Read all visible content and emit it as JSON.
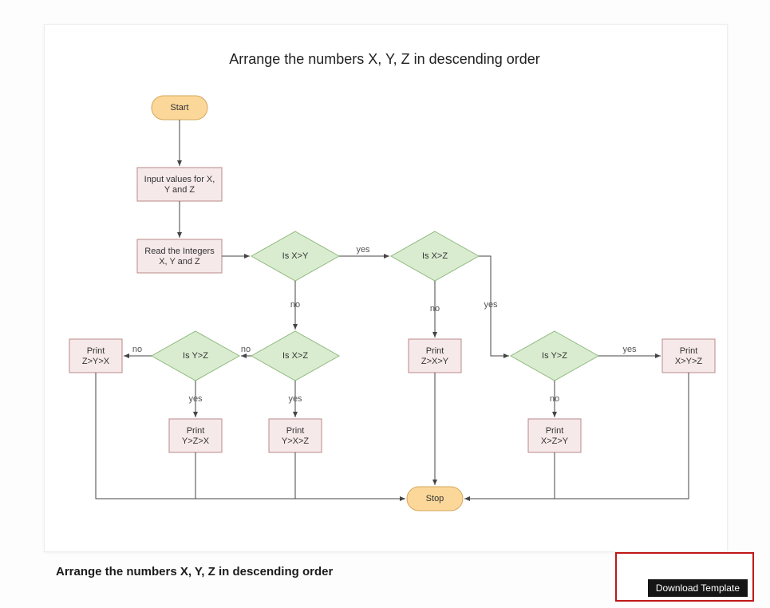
{
  "chart_data": {
    "type": "flowchart",
    "title": "Arrange the numbers X, Y, Z in descending order",
    "nodes": {
      "start": {
        "shape": "terminator",
        "label": "Start"
      },
      "input": {
        "shape": "process",
        "label": "Input values for X, Y and Z"
      },
      "read": {
        "shape": "process",
        "label": "Read the Integers X, Y and Z"
      },
      "dec_xy": {
        "shape": "decision",
        "label": "Is X>Y"
      },
      "dec_xz_top": {
        "shape": "decision",
        "label": "Is X>Z"
      },
      "dec_xz_mid": {
        "shape": "decision",
        "label": "Is X>Z"
      },
      "dec_yz_l": {
        "shape": "decision",
        "label": "Is Y>Z"
      },
      "dec_yz_r": {
        "shape": "decision",
        "label": "Is Y>Z"
      },
      "p_zyx": {
        "shape": "process",
        "label": "Print\nZ>Y>X"
      },
      "p_zxy": {
        "shape": "process",
        "label": "Print\nZ>X>Y"
      },
      "p_yzx": {
        "shape": "process",
        "label": "Print\nY>Z>X"
      },
      "p_yxz": {
        "shape": "process",
        "label": "Print\nY>X>Z"
      },
      "p_xzy": {
        "shape": "process",
        "label": "Print\nX>Z>Y"
      },
      "p_xyz": {
        "shape": "process",
        "label": "Print\nX>Y>Z"
      },
      "stop": {
        "shape": "terminator",
        "label": "Stop"
      }
    },
    "edges": [
      {
        "from": "start",
        "to": "input"
      },
      {
        "from": "input",
        "to": "read"
      },
      {
        "from": "read",
        "to": "dec_xy"
      },
      {
        "from": "dec_xy",
        "to": "dec_xz_top",
        "label": "yes"
      },
      {
        "from": "dec_xy",
        "to": "dec_xz_mid",
        "label": "no"
      },
      {
        "from": "dec_xz_top",
        "to": "dec_yz_r",
        "label": "yes"
      },
      {
        "from": "dec_xz_top",
        "to": "p_zxy",
        "label": "no"
      },
      {
        "from": "dec_xz_mid",
        "to": "p_yxz",
        "label": "yes"
      },
      {
        "from": "dec_xz_mid",
        "to": "dec_yz_l",
        "label": "no"
      },
      {
        "from": "dec_yz_l",
        "to": "p_yzx",
        "label": "yes"
      },
      {
        "from": "dec_yz_l",
        "to": "p_zyx",
        "label": "no"
      },
      {
        "from": "dec_yz_r",
        "to": "p_xyz",
        "label": "yes"
      },
      {
        "from": "dec_yz_r",
        "to": "p_xzy",
        "label": "no"
      },
      {
        "from": "p_zyx",
        "to": "stop"
      },
      {
        "from": "p_zxy",
        "to": "stop"
      },
      {
        "from": "p_yzx",
        "to": "stop"
      },
      {
        "from": "p_yxz",
        "to": "stop"
      },
      {
        "from": "p_xzy",
        "to": "stop"
      },
      {
        "from": "p_xyz",
        "to": "stop"
      }
    ]
  },
  "caption": "Arrange the numbers X, Y, Z in descending order",
  "tooltip": "Download Template",
  "icons": {
    "download": "download-icon",
    "desktop": "desktop-icon"
  }
}
